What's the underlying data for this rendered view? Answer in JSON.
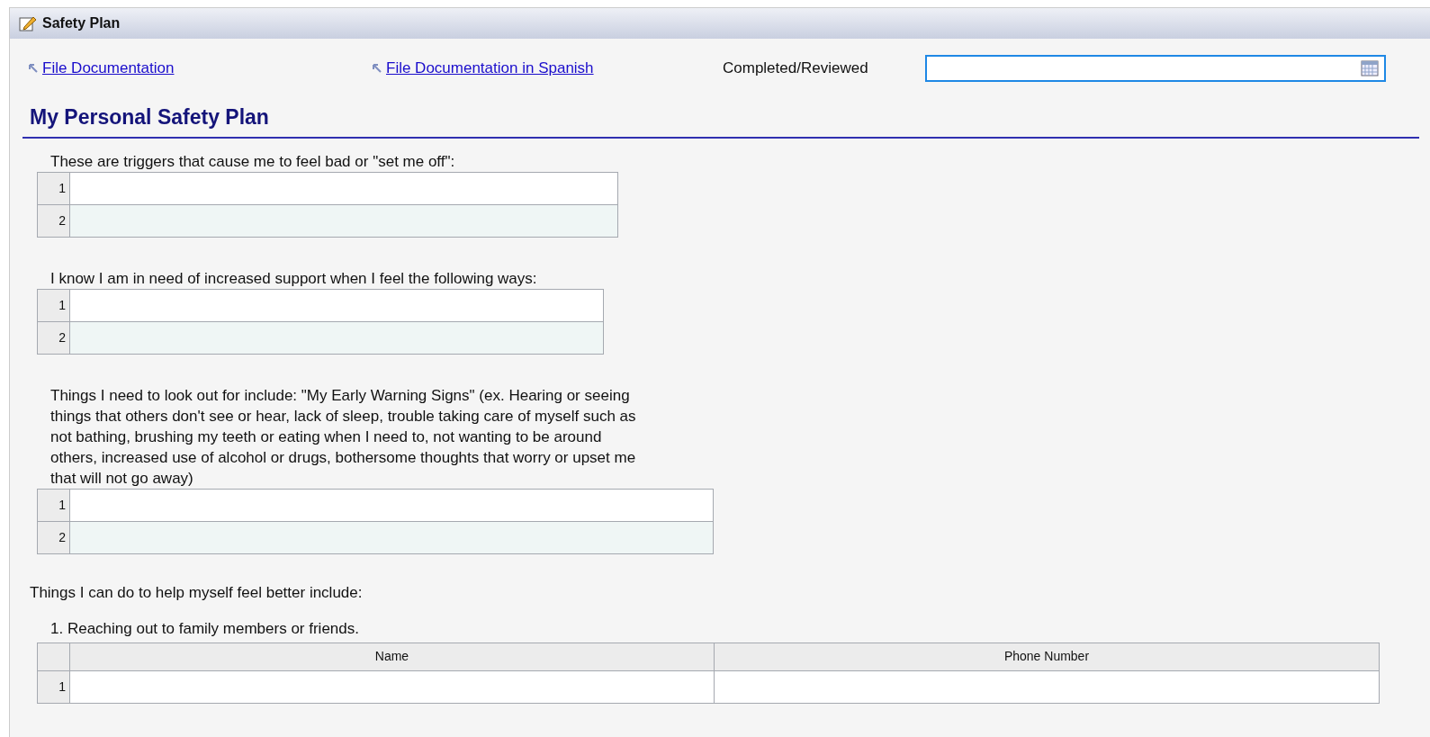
{
  "panel": {
    "title": "Safety Plan"
  },
  "links": [
    {
      "label": "File Documentation"
    },
    {
      "label": "File Documentation in Spanish"
    }
  ],
  "date_field": {
    "label": "Completed/Reviewed",
    "focused": true
  },
  "heading": "My Personal Safety Plan",
  "sections": [
    {
      "prompt": "These are triggers that cause me to feel bad or \"set me off\":",
      "rows": [
        "1",
        "2"
      ]
    },
    {
      "prompt": "I know I am in need of increased support when I feel the following ways:",
      "rows": [
        "1",
        "2"
      ]
    },
    {
      "prompt": "Things I need to look out for include: \"My Early Warning Signs\"  (ex. Hearing or seeing things that others don't see or hear, lack of sleep, trouble taking care of myself such as not bathing, brushing my teeth or eating when I need to, not wanting to be around others, increased use of alcohol or drugs, bothersome thoughts that worry or upset me that will not go away)",
      "rows": [
        "1",
        "2"
      ]
    }
  ],
  "better": {
    "intro": "Things I can do to help myself feel better include:",
    "item": "1. Reaching out to family members or friends.",
    "table": {
      "columns": [
        "Name",
        "Phone Number"
      ],
      "rows": [
        "1"
      ]
    }
  }
}
